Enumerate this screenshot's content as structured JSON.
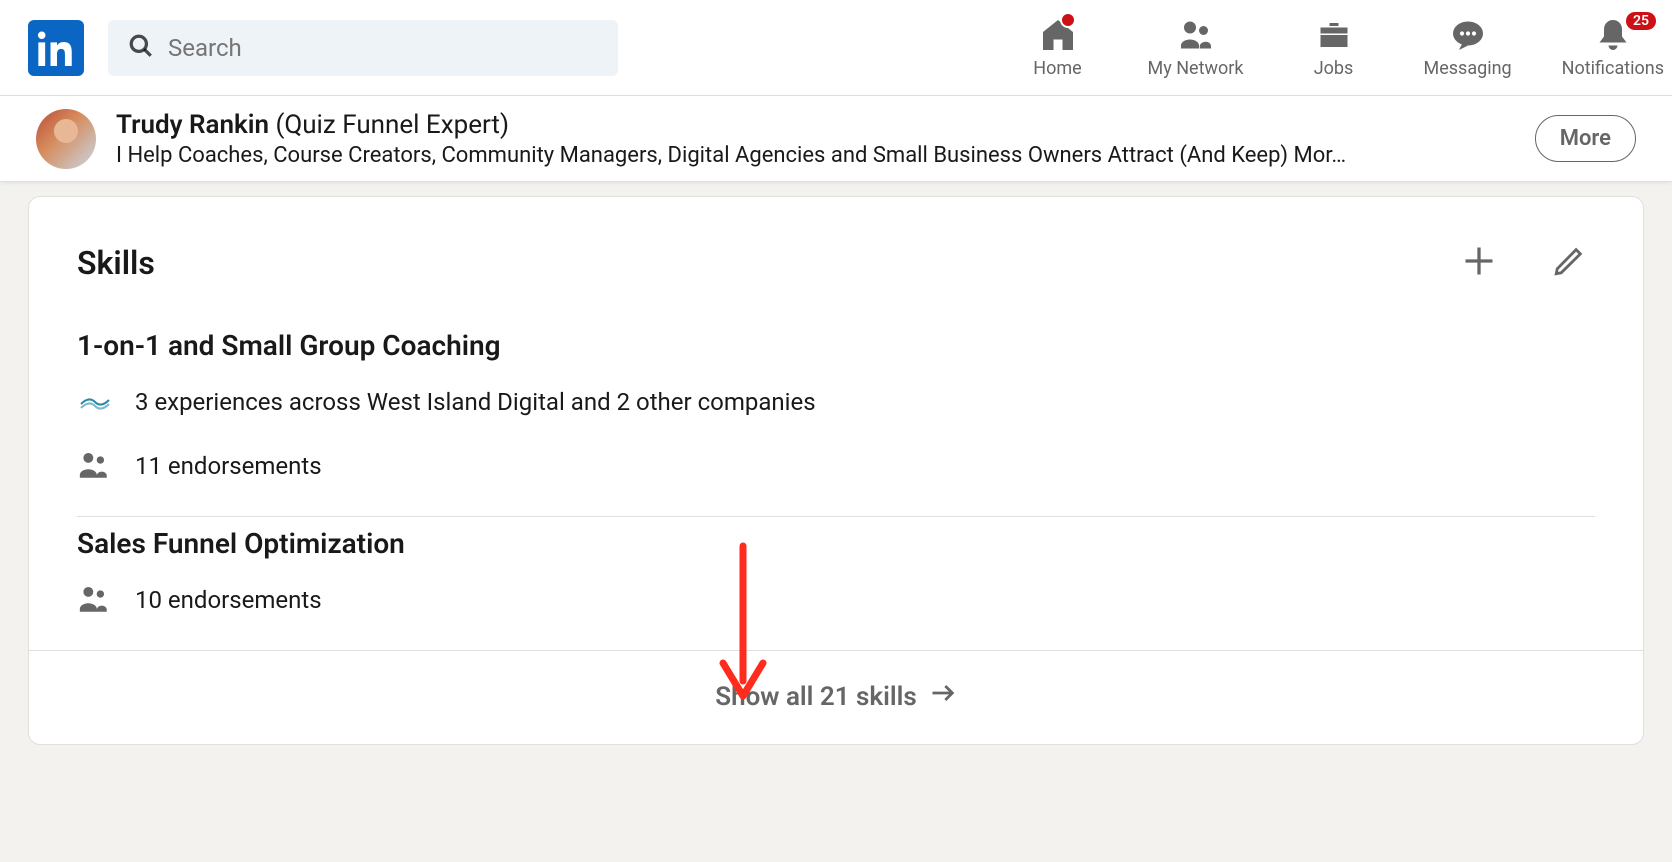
{
  "search": {
    "placeholder": "Search"
  },
  "nav": {
    "home": "Home",
    "network": "My Network",
    "jobs": "Jobs",
    "messaging": "Messaging",
    "notifications": "Notifications",
    "notifications_badge": "25"
  },
  "profile": {
    "name": "Trudy Rankin",
    "suffix": "(Quiz Funnel Expert)",
    "tagline": "I Help Coaches, Course Creators, Community Managers, Digital Agencies and Small Business Owners Attract (And Keep) Mor…",
    "more_label": "More"
  },
  "skills": {
    "section_title": "Skills",
    "items": [
      {
        "name": "1-on-1 and Small Group Coaching",
        "experience_line": "3 experiences across West Island Digital and 2 other companies",
        "endorsements": "11 endorsements"
      },
      {
        "name": "Sales Funnel Optimization",
        "endorsements": "10 endorsements"
      }
    ],
    "show_all": "Show all 21 skills"
  }
}
